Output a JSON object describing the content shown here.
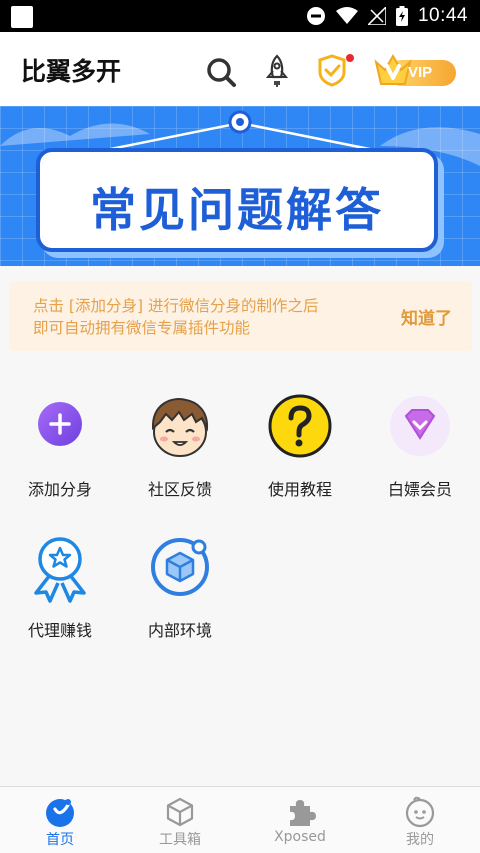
{
  "status_bar": {
    "time": "10:44"
  },
  "app": {
    "title": "比翼多开",
    "vip_label": "VIP"
  },
  "banner": {
    "title": "常见问题解答"
  },
  "tip": {
    "text": "点击 [添加分身] 进行微信分身的制作之后即可自动拥有微信专属插件功能",
    "action": "知道了"
  },
  "features": [
    {
      "label": "添加分身",
      "icon": "plus-circle-icon"
    },
    {
      "label": "社区反馈",
      "icon": "cartoon-face-icon"
    },
    {
      "label": "使用教程",
      "icon": "question-mark-icon"
    },
    {
      "label": "白嫖会员",
      "icon": "diamond-icon"
    },
    {
      "label": "代理赚钱",
      "icon": "award-ribbon-icon"
    },
    {
      "label": "内部环境",
      "icon": "box-circle-icon"
    }
  ],
  "bottom_nav": [
    {
      "label": "首页",
      "icon": "home-icon",
      "active": true
    },
    {
      "label": "工具箱",
      "icon": "toolbox-icon",
      "active": false
    },
    {
      "label": "Xposed",
      "icon": "puzzle-icon",
      "active": false
    },
    {
      "label": "我的",
      "icon": "profile-icon",
      "active": false
    }
  ],
  "colors": {
    "accent": "#1a73e8",
    "banner": "#2f86f5",
    "tip_bg": "#fdf2e3",
    "tip_text": "#e6a14a"
  }
}
